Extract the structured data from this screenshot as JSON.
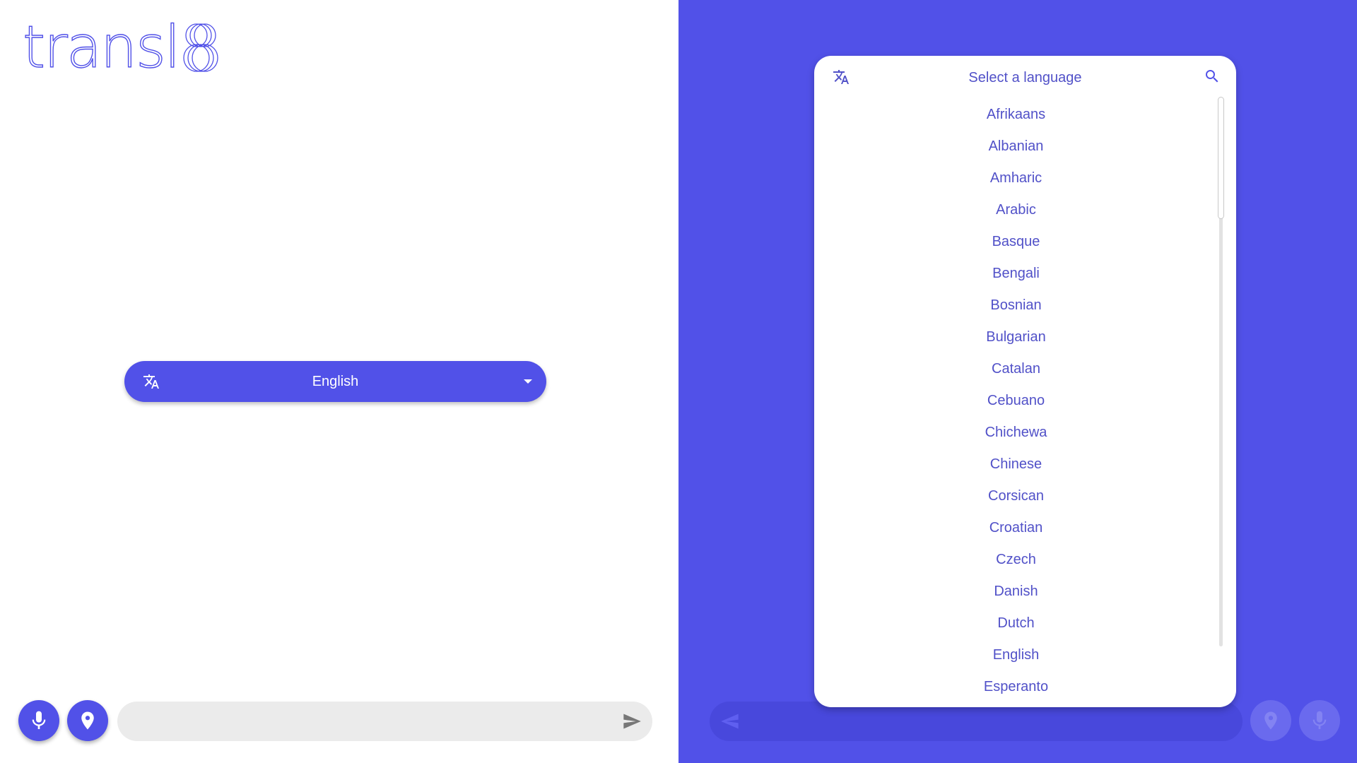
{
  "app": {
    "logo_text": "transl",
    "logo_suffix": "8"
  },
  "left": {
    "language_pill": {
      "icon": "translate-icon",
      "label": "English",
      "dropdown_icon": "caret-down-icon"
    },
    "bottom_bar": {
      "mic_icon": "microphone-icon",
      "location_icon": "location-pin-icon",
      "message_value": "",
      "send_icon": "send-icon"
    }
  },
  "right": {
    "language_picker": {
      "icon": "translate-icon",
      "search_placeholder": "Select a language",
      "search_icon": "search-icon",
      "languages": [
        "Afrikaans",
        "Albanian",
        "Amharic",
        "Arabic",
        "Basque",
        "Bengali",
        "Bosnian",
        "Bulgarian",
        "Catalan",
        "Cebuano",
        "Chichewa",
        "Chinese",
        "Corsican",
        "Croatian",
        "Czech",
        "Danish",
        "Dutch",
        "English",
        "Esperanto"
      ]
    },
    "bottom_bar": {
      "send_icon": "send-icon",
      "location_icon": "location-pin-icon",
      "mic_icon": "microphone-icon"
    }
  },
  "colors": {
    "accent": "#5151e8",
    "accent_dim": "#4848dc",
    "input_bg": "#ebebeb",
    "list_text": "#5151c8"
  }
}
